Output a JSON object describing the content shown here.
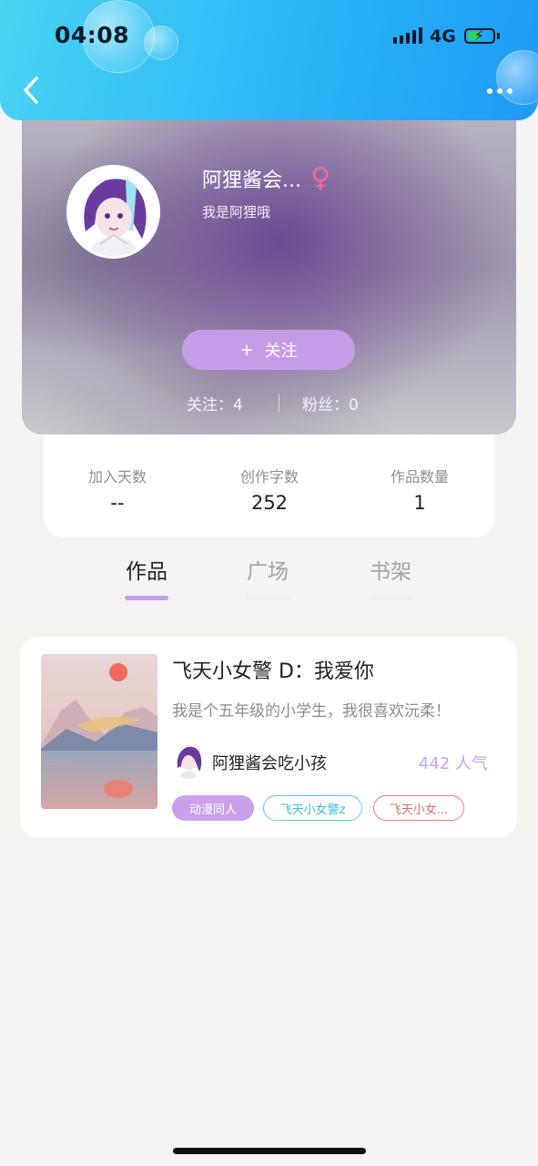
{
  "status_bar": {
    "time": "04:08",
    "network": "4G",
    "battery_state": "charging"
  },
  "header": {
    "back_icon": "chevron-left-icon",
    "more_icon": "more-dots-icon"
  },
  "profile": {
    "name": "阿狸酱会...",
    "gender_symbol": "♀",
    "bio": "我是阿狸哦",
    "follow_plus": "+",
    "follow_label": "关注",
    "following_text": "关注：4",
    "fans_text": "粉丝：0"
  },
  "stats": [
    {
      "label": "加入天数",
      "value": "--"
    },
    {
      "label": "创作字数",
      "value": "252"
    },
    {
      "label": "作品数量",
      "value": "1"
    }
  ],
  "tabs": [
    {
      "label": "作品",
      "active": true
    },
    {
      "label": "广场",
      "active": false
    },
    {
      "label": "书架",
      "active": false
    }
  ],
  "work": {
    "title": "飞天小女警 D：我爱你",
    "description": "我是个五年级的小学生，我很喜欢沅柔！",
    "author": "阿狸酱会吃小孩",
    "popularity": "442 人气",
    "tags": [
      "动漫同人",
      "飞天小女警z",
      "飞天小女..."
    ]
  },
  "colors": {
    "header_gradient_start": "#4ad3f3",
    "header_gradient_end": "#1f9af6",
    "accent_purple": "#c59ce8",
    "gender_pink": "#f0679b",
    "tag_cyan": "#5bd0ea",
    "tag_red": "#ee7c7c"
  }
}
